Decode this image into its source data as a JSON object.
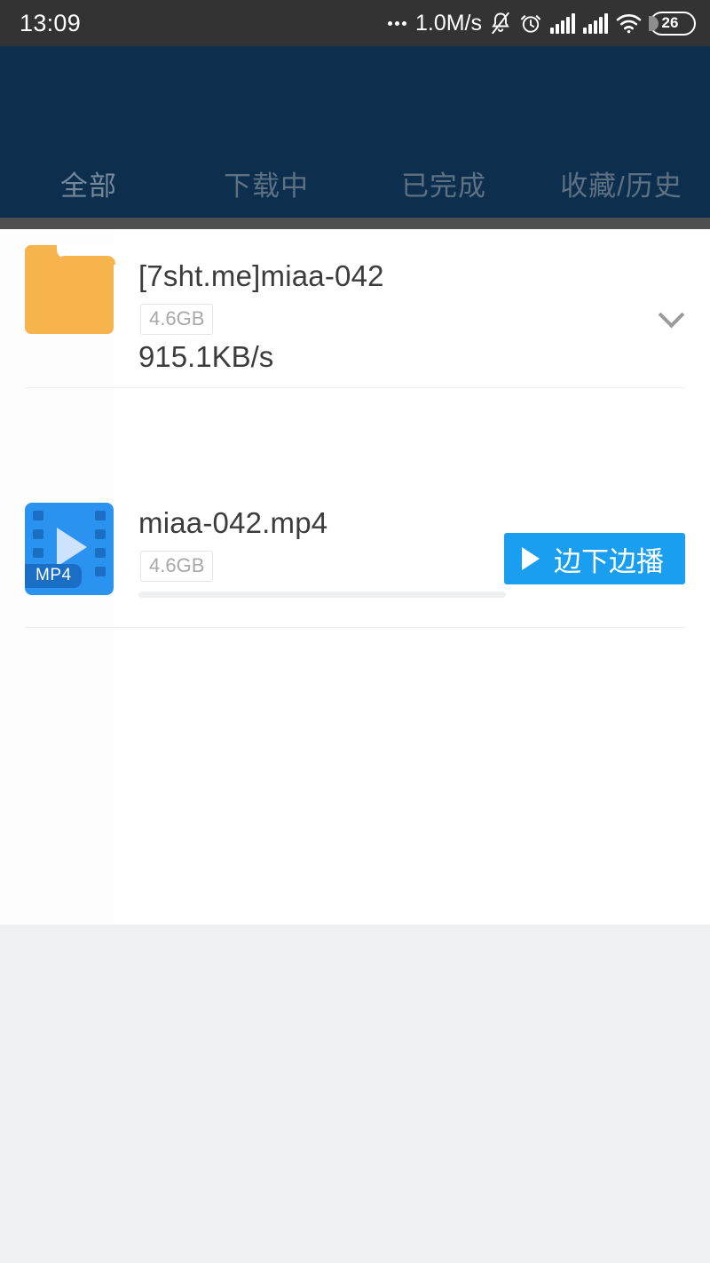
{
  "status_bar": {
    "time": "13:09",
    "network_speed": "1.0M/s",
    "battery_percent": "26",
    "icons": [
      "more-dots-icon",
      "notification-muted-icon",
      "alarm-clock-icon",
      "signal-bars-icon",
      "signal-bars-icon",
      "wifi-icon",
      "battery-icon"
    ]
  },
  "header": {
    "background_color": "#0d2e4d",
    "tabs": [
      {
        "label": "全部",
        "active": true
      },
      {
        "label": "下载中",
        "active": false
      },
      {
        "label": "已完成",
        "active": false
      },
      {
        "label": "收藏/历史",
        "active": false
      }
    ]
  },
  "download_list": {
    "items": [
      {
        "icon": "folder-icon",
        "icon_color": "#f7b44d",
        "title": "[7sht.me]miaa-042",
        "size": "4.6GB",
        "speed": "915.1KB/s",
        "expand_icon": "chevron-down-icon"
      },
      {
        "icon": "mp4-video-icon",
        "icon_color": "#2a92ef",
        "icon_label": "MP4",
        "title": "miaa-042.mp4",
        "size": "4.6GB",
        "progress_percent": 0,
        "action_button": {
          "label": "边下边播",
          "icon": "play-icon",
          "color": "#1a9ff0"
        }
      }
    ]
  },
  "colors": {
    "status_bar": "#333333",
    "header_navy": "#0d2e4d",
    "header_strip": "#4f4f4f",
    "content_bg": "#ffffff",
    "page_bg": "#eff0f2",
    "accent_blue": "#1a9ff0",
    "folder_orange": "#f7b44d"
  }
}
